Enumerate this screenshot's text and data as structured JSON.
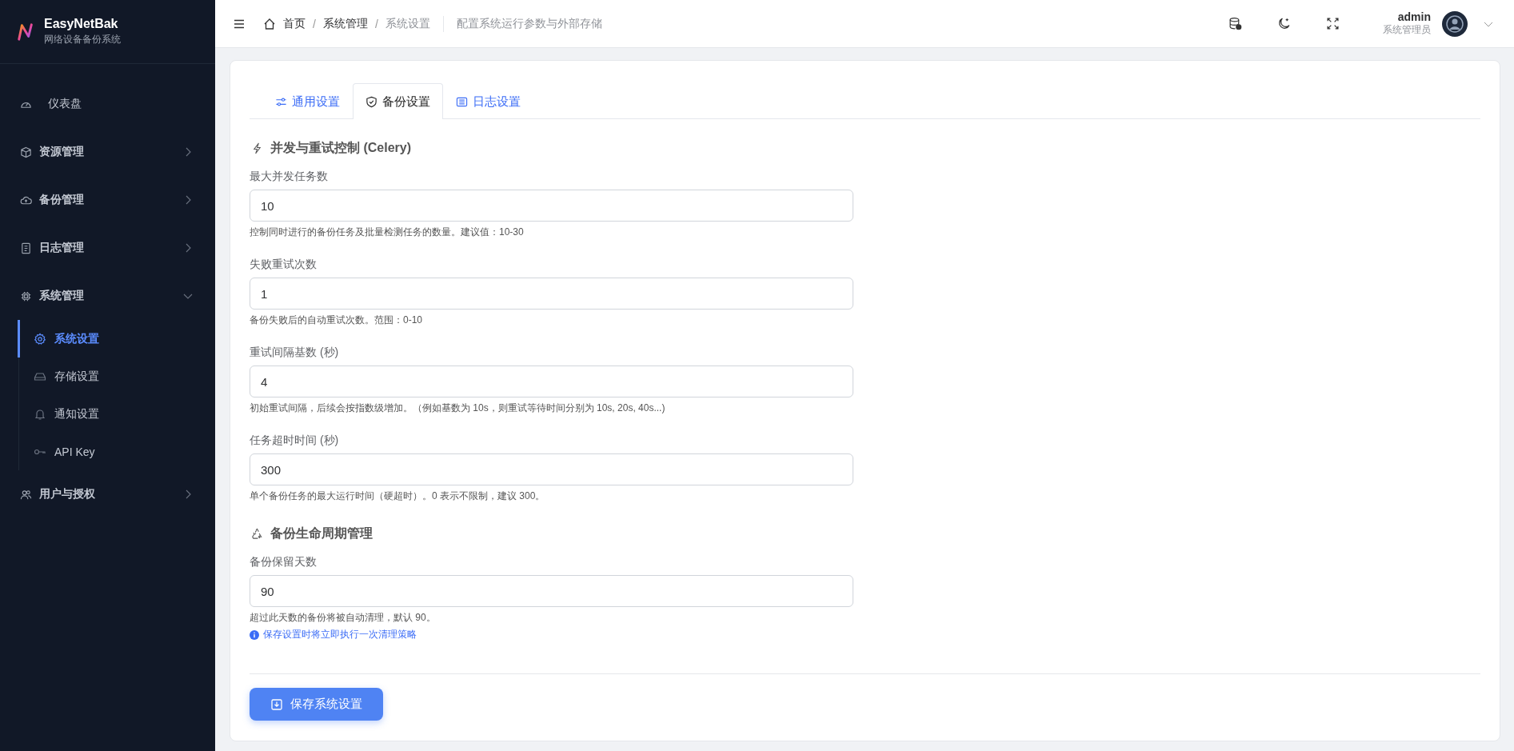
{
  "brand": {
    "name": "EasyNetBak",
    "subtitle": "网络设备备份系统"
  },
  "sidebar": {
    "items": [
      {
        "label": "仪表盘",
        "kind": "item",
        "selected": false
      },
      {
        "label": "资源管理",
        "kind": "group",
        "expanded": false
      },
      {
        "label": "备份管理",
        "kind": "group",
        "expanded": false
      },
      {
        "label": "日志管理",
        "kind": "group",
        "expanded": false
      },
      {
        "label": "系统管理",
        "kind": "group",
        "expanded": true,
        "children": [
          {
            "label": "系统设置",
            "selected": true
          },
          {
            "label": "存储设置",
            "selected": false
          },
          {
            "label": "通知设置",
            "selected": false
          },
          {
            "label": "API Key",
            "selected": false
          }
        ]
      },
      {
        "label": "用户与授权",
        "kind": "group",
        "expanded": false
      }
    ]
  },
  "header": {
    "breadcrumb": [
      "首页",
      "系统管理",
      "系统设置"
    ],
    "breadcrumb_separator": "/",
    "description": "配置系统运行参数与外部存储",
    "user": {
      "name": "admin",
      "role": "系统管理员"
    }
  },
  "tabs": [
    {
      "label": "通用设置",
      "selected": false
    },
    {
      "label": "备份设置",
      "selected": true
    },
    {
      "label": "日志设置",
      "selected": false
    }
  ],
  "sections": [
    {
      "title": "并发与重试控制 (Celery)",
      "fields": [
        {
          "label": "最大并发任务数",
          "value": "10",
          "help": "控制同时进行的备份任务及批量检测任务的数量。建议值：10-30"
        },
        {
          "label": "失败重试次数",
          "value": "1",
          "help": "备份失败后的自动重试次数。范围：0-10"
        },
        {
          "label": "重试间隔基数 (秒)",
          "value": "4",
          "help": "初始重试间隔，后续会按指数级增加。（例如基数为 10s，则重试等待时间分别为 10s, 20s, 40s...)"
        },
        {
          "label": "任务超时时间 (秒)",
          "value": "300",
          "help": "单个备份任务的最大运行时间（硬超时）。0 表示不限制，建议 300。"
        }
      ]
    },
    {
      "title": "备份生命周期管理",
      "fields": [
        {
          "label": "备份保留天数",
          "value": "90",
          "help": "超过此天数的备份将被自动清理，默认 90。",
          "note": "保存设置时将立即执行一次清理策略"
        }
      ]
    }
  ],
  "save_button": "保存系统设置"
}
